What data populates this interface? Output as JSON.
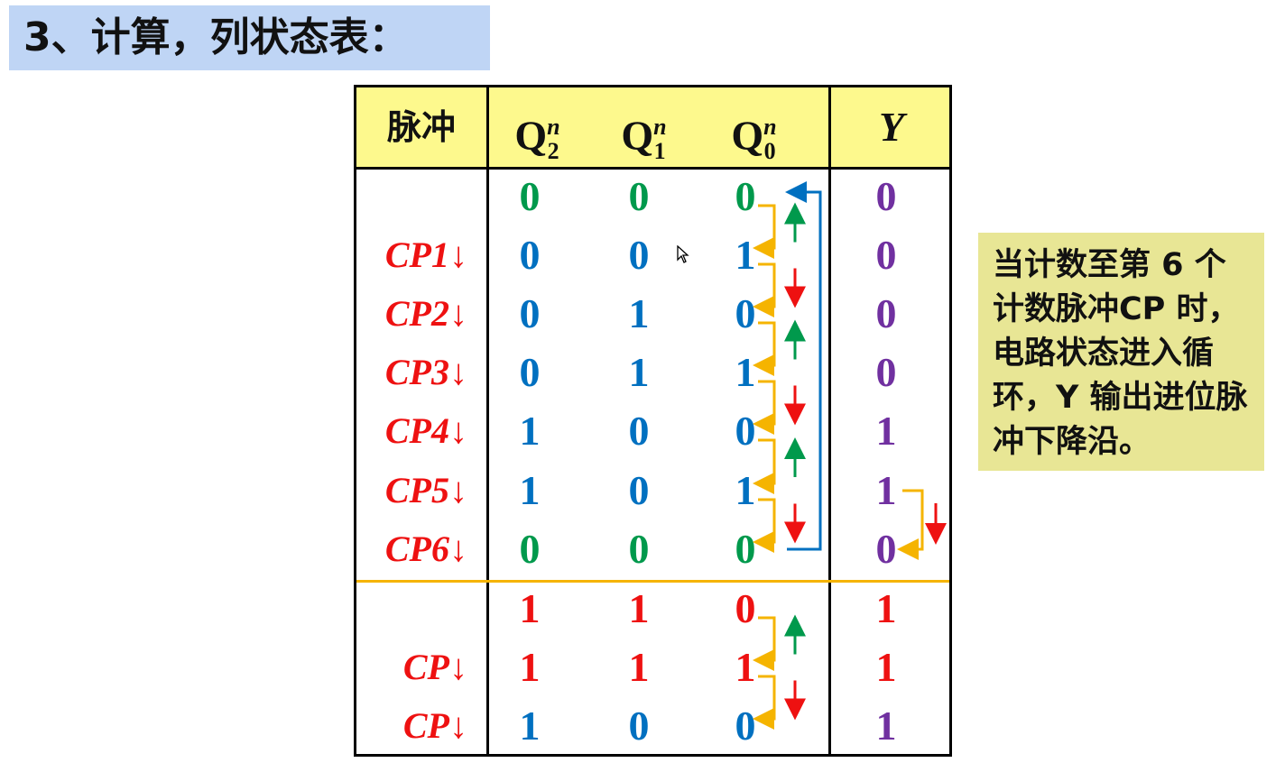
{
  "title": "3、计算，列状态表：",
  "header": {
    "pulse": "脉冲",
    "q2": "Q",
    "q2_sup": "n",
    "q2_sub": "2",
    "q1": "Q",
    "q1_sup": "n",
    "q1_sub": "1",
    "q0": "Q",
    "q0_sup": "n",
    "q0_sub": "0",
    "y": "Y"
  },
  "rows": [
    {
      "pulse": "",
      "q2": "0",
      "q1": "0",
      "q0": "0",
      "y": "0"
    },
    {
      "pulse": "CP1",
      "q2": "0",
      "q1": "0",
      "q0": "1",
      "y": "0"
    },
    {
      "pulse": "CP2",
      "q2": "0",
      "q1": "1",
      "q0": "0",
      "y": "0"
    },
    {
      "pulse": "CP3",
      "q2": "0",
      "q1": "1",
      "q0": "1",
      "y": "0"
    },
    {
      "pulse": "CP4",
      "q2": "1",
      "q1": "0",
      "q0": "0",
      "y": "1"
    },
    {
      "pulse": "CP5",
      "q2": "1",
      "q1": "0",
      "q0": "1",
      "y": "1"
    },
    {
      "pulse": "CP6",
      "q2": "0",
      "q1": "0",
      "q0": "0",
      "y": "0"
    },
    {
      "pulse": "",
      "q2": "1",
      "q1": "1",
      "q0": "0",
      "y": "1"
    },
    {
      "pulse": "CP",
      "q2": "1",
      "q1": "1",
      "q0": "1",
      "y": "1"
    },
    {
      "pulse": "CP",
      "q2": "1",
      "q1": "0",
      "q0": "0",
      "y": "1"
    }
  ],
  "pulse_arrow": "↓",
  "note": "当计数至第 6 个计数脉冲CP 时，电路状态进入循环，Y 输出进位脉冲下降沿。",
  "colors": {
    "title_bg": "#bfd5f5",
    "header_bg": "#fdf98d",
    "q2_col": "#0070c0",
    "q1_col": "#0070c0",
    "q0_col": "#0070c0",
    "initial_green": "#00994c",
    "y_purple": "#7030a0",
    "unused_red": "#ee1111",
    "orange": "#f5b400",
    "note_bg": "#e8e695"
  }
}
